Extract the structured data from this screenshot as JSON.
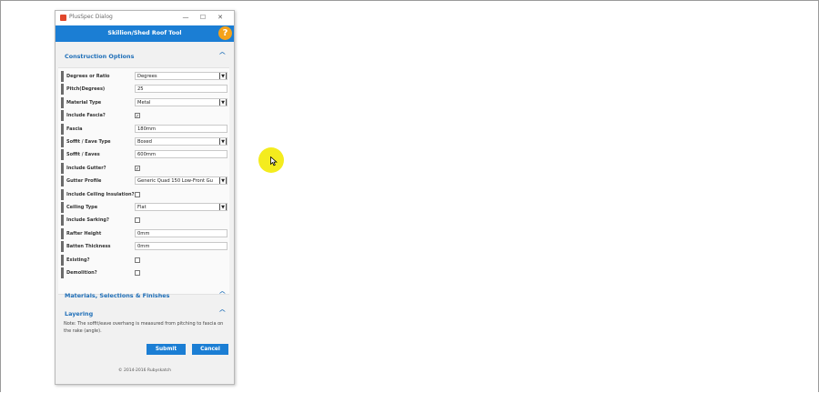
{
  "window": {
    "title": "PlusSpec Dialog",
    "controls": [
      "—",
      "☐",
      "✕"
    ]
  },
  "banner": {
    "title": "Skillion/Shed Roof Tool",
    "help_label": "?"
  },
  "sections": {
    "construction": "Construction Options",
    "materials": "Materials, Selections & Finishes",
    "layering": "Layering"
  },
  "fields": [
    {
      "label": "Degrees or Ratio",
      "kind": "select",
      "value": "Degrees"
    },
    {
      "label": "Pitch(Degrees)",
      "kind": "text",
      "value": "25"
    },
    {
      "label": "Material Type",
      "kind": "select",
      "value": "Metal"
    },
    {
      "label": "Include Fascia?",
      "kind": "checkbox",
      "checked": true
    },
    {
      "label": "Fascia",
      "kind": "text",
      "value": "180mm"
    },
    {
      "label": "Soffit / Eave Type",
      "kind": "select",
      "value": "Boxed"
    },
    {
      "label": "Soffit / Eaves",
      "kind": "text",
      "value": "600mm"
    },
    {
      "label": "Include Gutter?",
      "kind": "checkbox",
      "checked": true
    },
    {
      "label": "Gutter Profile",
      "kind": "select",
      "value": "Generic Quad 150 Low-Front Gu"
    },
    {
      "label": "Include Ceiling Insulation?",
      "kind": "checkbox",
      "checked": false
    },
    {
      "label": "Ceiling Type",
      "kind": "select",
      "value": "Flat"
    },
    {
      "label": "Include Sarking?",
      "kind": "checkbox",
      "checked": false
    },
    {
      "label": "Rafter Height",
      "kind": "text",
      "value": "0mm"
    },
    {
      "label": "Batten Thickness",
      "kind": "text",
      "value": "0mm"
    },
    {
      "label": "Existing?",
      "kind": "checkbox",
      "checked": false
    },
    {
      "label": "Demolition?",
      "kind": "checkbox",
      "checked": false
    }
  ],
  "note": "Note: The soffit/eave overhang is measured from pitching to fascia on the rake (angle).",
  "buttons": {
    "submit": "Submit",
    "cancel": "Cancel"
  },
  "footer": "© 2014-2016 Rubyskatch",
  "colors": {
    "accent": "#1b7ed4",
    "help": "#f5a21a",
    "highlight": "#f4ec1e"
  }
}
